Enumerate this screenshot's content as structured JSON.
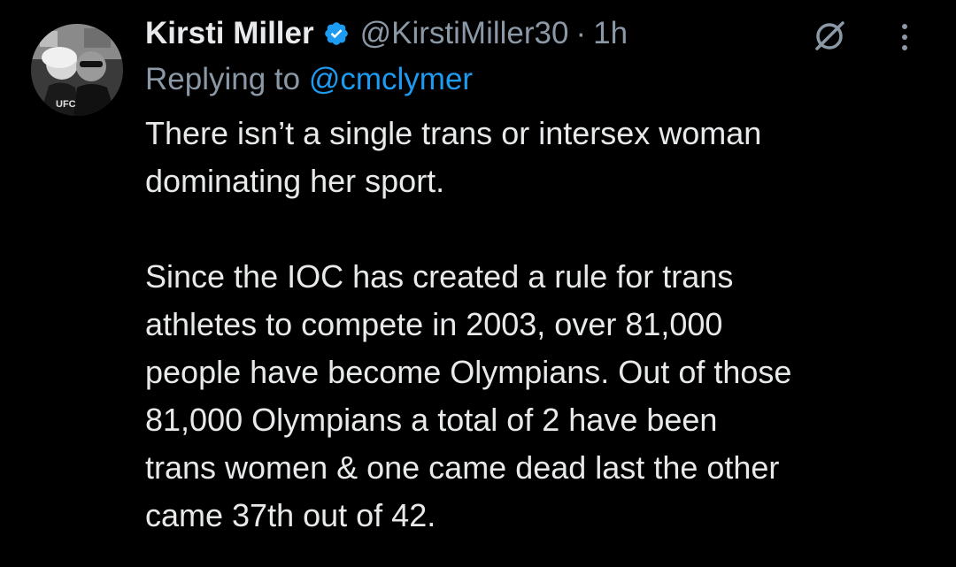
{
  "author": {
    "name": "Kirsti Miller",
    "handle": "@KirstiMiller30",
    "separator": "·",
    "time": "1h",
    "avatar_icon": "profile-photo"
  },
  "reply": {
    "prefix": "Replying to ",
    "target": "@cmclymer"
  },
  "tweet": {
    "paragraphs": [
      "There isn’t a single trans or intersex woman\ndominating her sport.",
      "Since the IOC has created a rule for trans\nathletes to compete in 2003, over 81,000\npeople have become Olympians. Out of those\n81,000 Olympians a total of 2 have been\ntrans women & one came dead last the other\ncame 37th out of 42."
    ]
  },
  "icons": {
    "verified": "verified-badge-icon",
    "grok": "grok-icon",
    "more": "more-options-icon"
  },
  "colors": {
    "background": "#000000",
    "text": "#e7e9ea",
    "secondary": "#8b98a5",
    "accent": "#1d9bf0"
  }
}
